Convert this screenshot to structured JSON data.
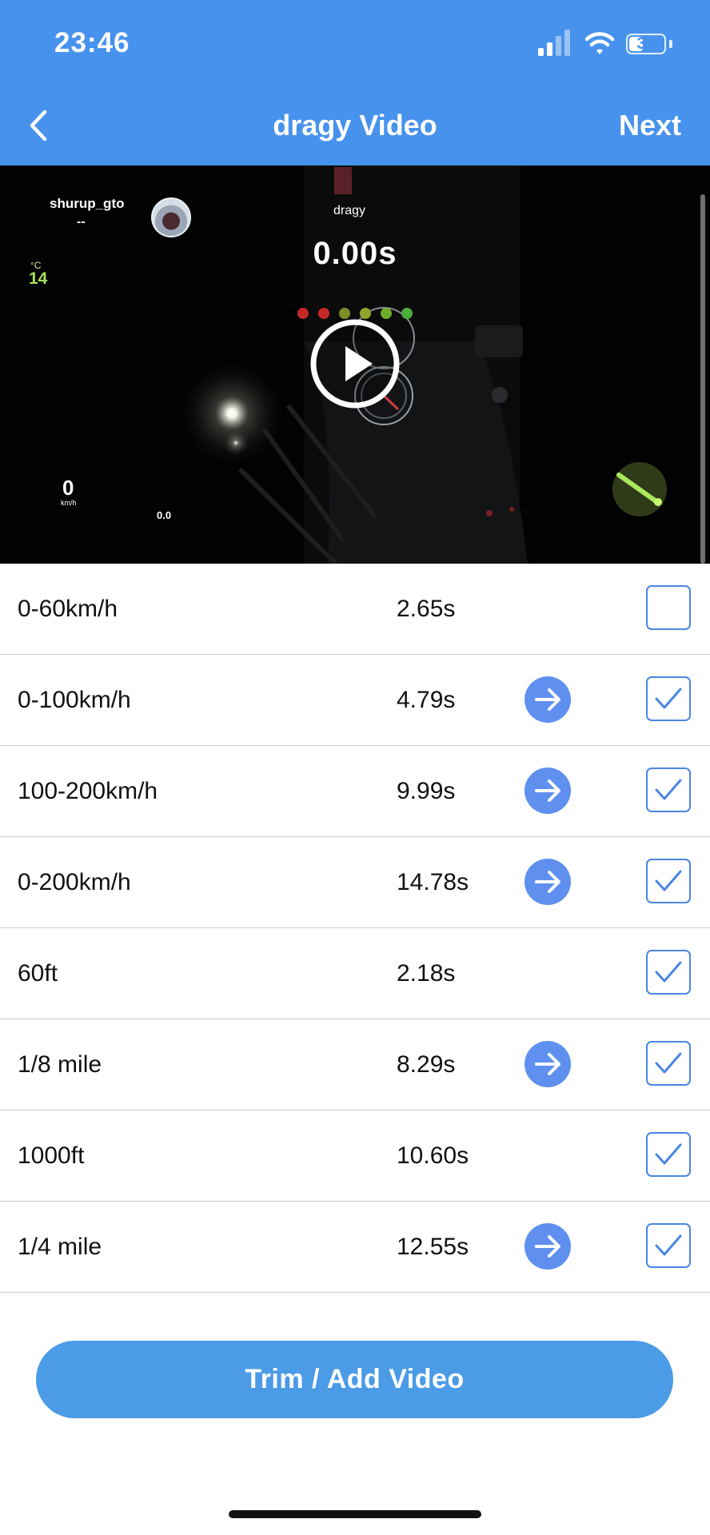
{
  "status_bar": {
    "time": "23:46",
    "battery_level": "38"
  },
  "header": {
    "title": "dragy Video",
    "next_label": "Next"
  },
  "video": {
    "username": "shurup_gto",
    "username_sub": "--",
    "brand": "dragy",
    "timer": "0.00s",
    "temperature_unit": "°C",
    "temperature": "14",
    "speed": "0",
    "speed_unit": "km/h",
    "distance": "0.0",
    "light_colors": [
      "#c62828",
      "#c62828",
      "#7a8f25",
      "#8fa62a",
      "#6fae2d",
      "#4caf3c"
    ]
  },
  "results": [
    {
      "label": "0-60km/h",
      "time": "2.65s",
      "has_arrow": false,
      "checked": false
    },
    {
      "label": "0-100km/h",
      "time": "4.79s",
      "has_arrow": true,
      "checked": true
    },
    {
      "label": "100-200km/h",
      "time": "9.99s",
      "has_arrow": true,
      "checked": true
    },
    {
      "label": "0-200km/h",
      "time": "14.78s",
      "has_arrow": true,
      "checked": true
    },
    {
      "label": "60ft",
      "time": "2.18s",
      "has_arrow": false,
      "checked": true
    },
    {
      "label": "1/8 mile",
      "time": "8.29s",
      "has_arrow": true,
      "checked": true
    },
    {
      "label": "1000ft",
      "time": "10.60s",
      "has_arrow": false,
      "checked": true
    },
    {
      "label": "1/4 mile",
      "time": "12.55s",
      "has_arrow": true,
      "checked": true
    }
  ],
  "actions": {
    "trim_label": "Trim / Add Video"
  },
  "colors": {
    "header_bg": "#4792ec",
    "checkbox": "#4a86e2",
    "arrow_btn": "#5f90f0",
    "button_bg": "#4b9be6"
  }
}
